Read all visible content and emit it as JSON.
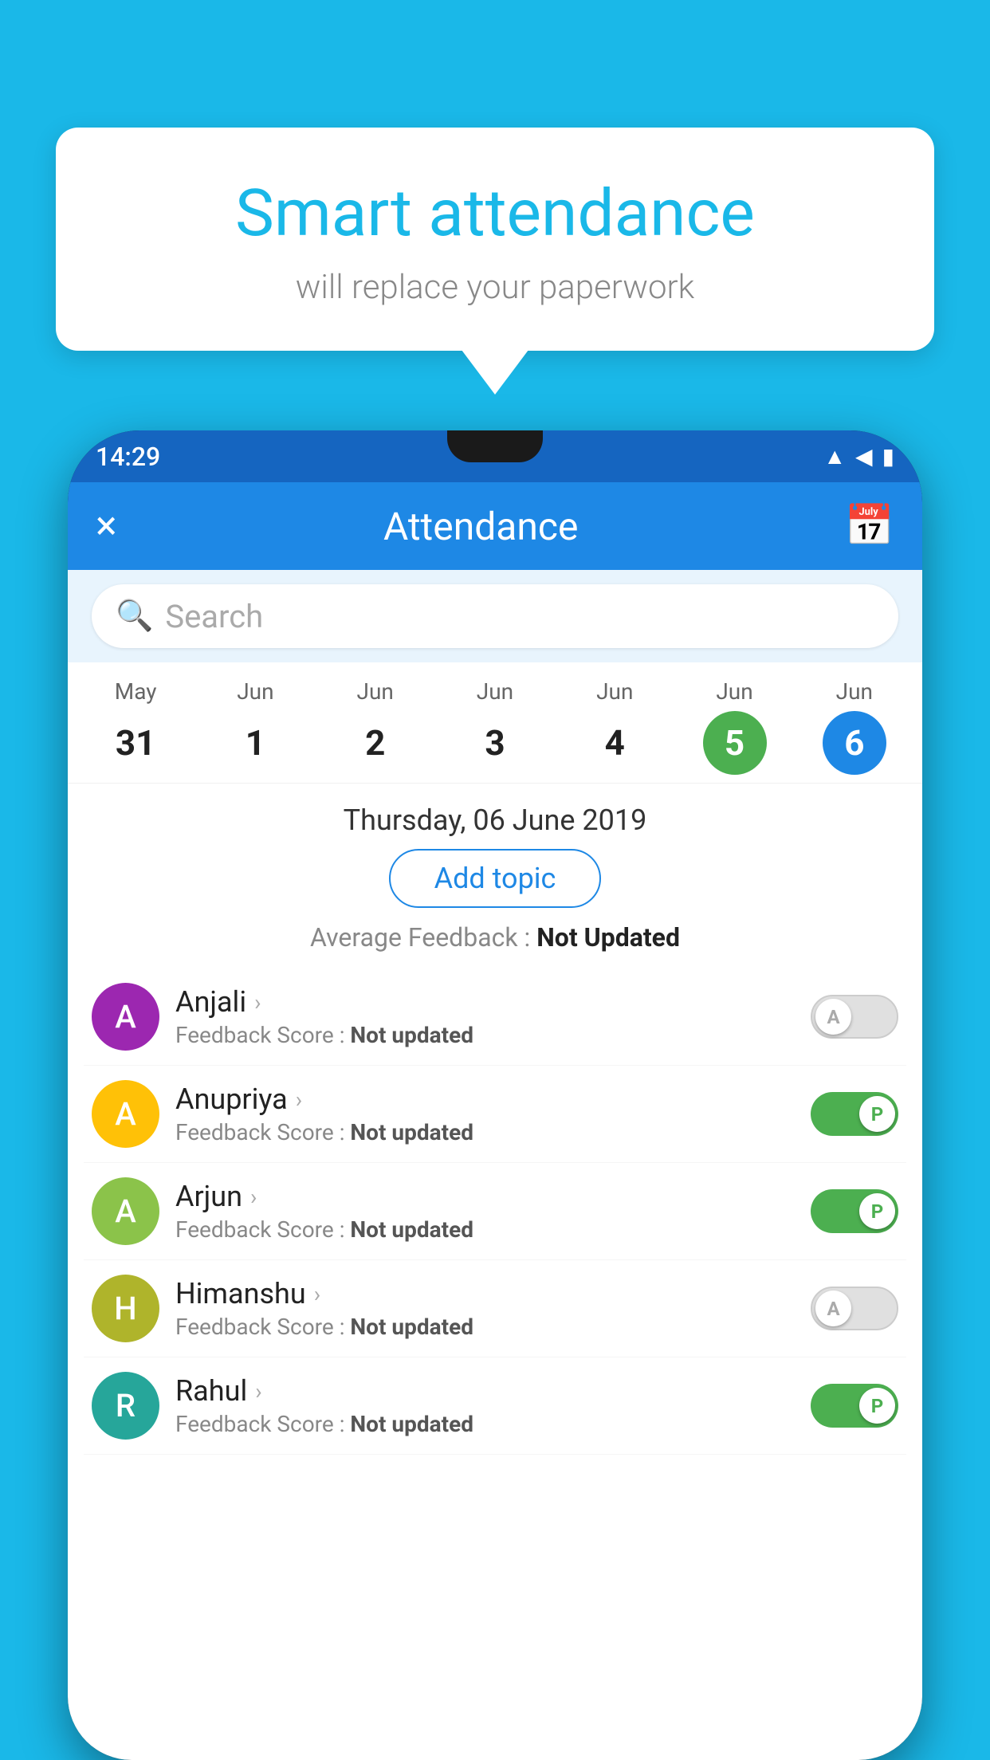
{
  "background_color": "#1ab8e8",
  "bubble": {
    "title": "Smart attendance",
    "subtitle": "will replace your paperwork"
  },
  "status_bar": {
    "time": "14:29",
    "icons": [
      "wifi",
      "signal",
      "battery"
    ]
  },
  "app_bar": {
    "title": "Attendance",
    "close_label": "×",
    "calendar_icon": "📅"
  },
  "search": {
    "placeholder": "Search"
  },
  "calendar": {
    "days": [
      {
        "month": "May",
        "date": "31",
        "state": "normal"
      },
      {
        "month": "Jun",
        "date": "1",
        "state": "normal"
      },
      {
        "month": "Jun",
        "date": "2",
        "state": "normal"
      },
      {
        "month": "Jun",
        "date": "3",
        "state": "normal"
      },
      {
        "month": "Jun",
        "date": "4",
        "state": "normal"
      },
      {
        "month": "Jun",
        "date": "5",
        "state": "today"
      },
      {
        "month": "Jun",
        "date": "6",
        "state": "selected"
      }
    ]
  },
  "selected_date": "Thursday, 06 June 2019",
  "add_topic_label": "Add topic",
  "average_feedback": {
    "label": "Average Feedback : ",
    "value": "Not Updated"
  },
  "students": [
    {
      "name": "Anjali",
      "initial": "A",
      "avatar_color": "av-purple",
      "feedback_label": "Feedback Score : ",
      "feedback_value": "Not updated",
      "toggle": "off",
      "toggle_letter": "A"
    },
    {
      "name": "Anupriya",
      "initial": "A",
      "avatar_color": "av-yellow",
      "feedback_label": "Feedback Score : ",
      "feedback_value": "Not updated",
      "toggle": "on",
      "toggle_letter": "P"
    },
    {
      "name": "Arjun",
      "initial": "A",
      "avatar_color": "av-green-light",
      "feedback_label": "Feedback Score : ",
      "feedback_value": "Not updated",
      "toggle": "on",
      "toggle_letter": "P"
    },
    {
      "name": "Himanshu",
      "initial": "H",
      "avatar_color": "av-khaki",
      "feedback_label": "Feedback Score : ",
      "feedback_value": "Not updated",
      "toggle": "off",
      "toggle_letter": "A"
    },
    {
      "name": "Rahul",
      "initial": "R",
      "avatar_color": "av-teal",
      "feedback_label": "Feedback Score : ",
      "feedback_value": "Not updated",
      "toggle": "on",
      "toggle_letter": "P"
    }
  ]
}
